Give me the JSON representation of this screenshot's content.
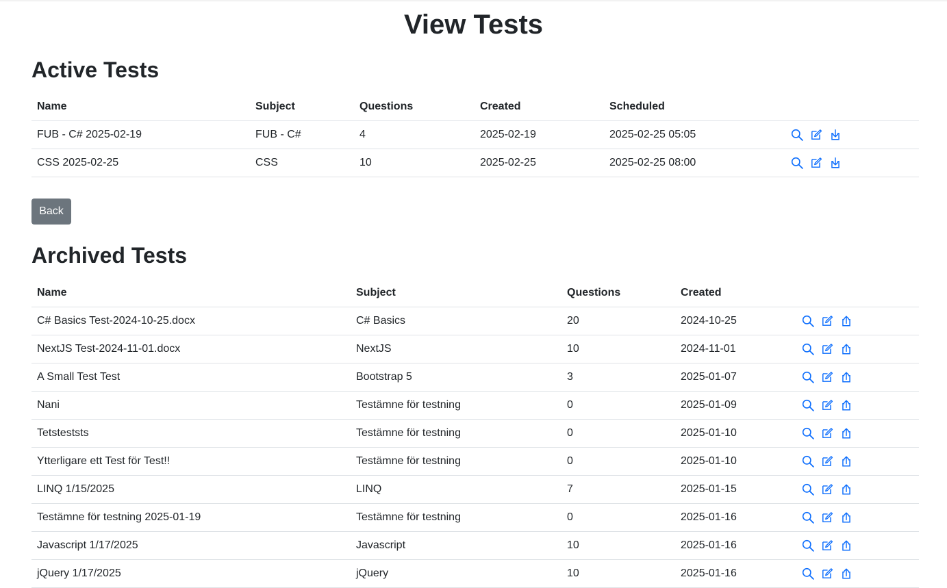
{
  "page": {
    "title": "View Tests"
  },
  "active": {
    "heading": "Active Tests",
    "columns": [
      "Name",
      "Subject",
      "Questions",
      "Created",
      "Scheduled"
    ],
    "rows": [
      {
        "name": "FUB - C# 2025-02-19",
        "subject": "FUB - C#",
        "questions": "4",
        "created": "2025-02-19",
        "scheduled": "2025-02-25 05:05"
      },
      {
        "name": "CSS 2025-02-25",
        "subject": "CSS",
        "questions": "10",
        "created": "2025-02-25",
        "scheduled": "2025-02-25 08:00"
      }
    ],
    "row_icons": [
      "search-icon",
      "edit-icon",
      "download-icon"
    ]
  },
  "back_button": {
    "label": "Back"
  },
  "archived": {
    "heading": "Archived Tests",
    "columns": [
      "Name",
      "Subject",
      "Questions",
      "Created"
    ],
    "rows": [
      {
        "name": "C# Basics Test-2024-10-25.docx",
        "subject": "C# Basics",
        "questions": "20",
        "created": "2024-10-25"
      },
      {
        "name": "NextJS Test-2024-11-01.docx",
        "subject": "NextJS",
        "questions": "10",
        "created": "2024-11-01"
      },
      {
        "name": "A Small Test Test",
        "subject": "Bootstrap 5",
        "questions": "3",
        "created": "2025-01-07"
      },
      {
        "name": "Nani",
        "subject": "Testämne för testning",
        "questions": "0",
        "created": "2025-01-09"
      },
      {
        "name": "Tetsteststs",
        "subject": "Testämne för testning",
        "questions": "0",
        "created": "2025-01-10"
      },
      {
        "name": "Ytterligare ett Test för Test!!",
        "subject": "Testämne för testning",
        "questions": "0",
        "created": "2025-01-10"
      },
      {
        "name": "LINQ 1/15/2025",
        "subject": "LINQ",
        "questions": "7",
        "created": "2025-01-15"
      },
      {
        "name": "Testämne för testning 2025-01-19",
        "subject": "Testämne för testning",
        "questions": "0",
        "created": "2025-01-16"
      },
      {
        "name": "Javascript 1/17/2025",
        "subject": "Javascript",
        "questions": "10",
        "created": "2025-01-16"
      },
      {
        "name": "jQuery 1/17/2025",
        "subject": "jQuery",
        "questions": "10",
        "created": "2025-01-16"
      }
    ],
    "row_icons": [
      "search-icon",
      "edit-icon",
      "upload-icon"
    ]
  },
  "colors": {
    "icon": "#0d6efd",
    "button_bg": "#6c757d",
    "border": "#dee2e6"
  }
}
